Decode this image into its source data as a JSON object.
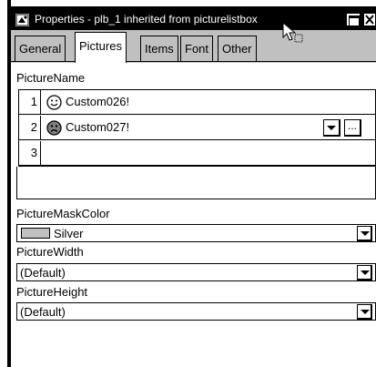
{
  "titlebar": {
    "title": "Properties - plb_1 inherited from picturelistbox"
  },
  "tabs": [
    {
      "label": "General",
      "active": false
    },
    {
      "label": "Pictures",
      "active": true
    },
    {
      "label": "Items",
      "active": false
    },
    {
      "label": "Font",
      "active": false
    },
    {
      "label": "Other",
      "active": false
    }
  ],
  "picture_name": {
    "label": "PictureName",
    "rows": [
      {
        "num": "1",
        "icon": "smiley-happy-icon",
        "value": "Custom026!"
      },
      {
        "num": "2",
        "icon": "smiley-sad-icon",
        "value": "Custom027!"
      },
      {
        "num": "3",
        "icon": "",
        "value": ""
      }
    ],
    "ellipsis": "..."
  },
  "mask_color": {
    "label": "PictureMaskColor",
    "value": "Silver",
    "swatch_color": "#c0c0c0"
  },
  "width": {
    "label": "PictureWidth",
    "value": "(Default)"
  },
  "height": {
    "label": "PictureHeight",
    "value": "(Default)"
  }
}
